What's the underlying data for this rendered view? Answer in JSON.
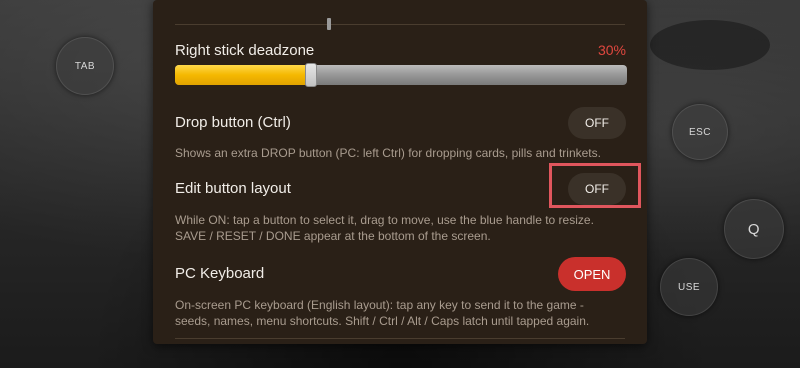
{
  "background_controls": {
    "tab_label": "TAB",
    "esc_label": "ESC",
    "q_label": "Q",
    "use_label": "USE"
  },
  "settings": {
    "deadzone": {
      "title": "Right stick deadzone",
      "value_text": "30%",
      "value_fraction": 0.3
    },
    "drop_button": {
      "title": "Drop button (Ctrl)",
      "toggle_label": "OFF",
      "description": "Shows an extra DROP button (PC: left Ctrl) for dropping cards, pills and trinkets."
    },
    "edit_layout": {
      "title": "Edit button layout",
      "toggle_label": "OFF",
      "description": "While ON: tap a button to select it, drag to move, use the blue handle to resize. SAVE / RESET / DONE appear at the bottom of the screen."
    },
    "pc_keyboard": {
      "title": "PC Keyboard",
      "button_label": "OPEN",
      "description": "On-screen PC keyboard (English layout): tap any key to send it to the game - seeds, names, menu shortcuts. Shift / Ctrl / Alt / Caps latch until tapped again."
    }
  },
  "colors": {
    "panel_bg": "#2a2017",
    "accent_red": "#e0473f",
    "open_button": "#c9302c",
    "slider_fill": "#f5b800",
    "highlight_box": "#e0565d"
  }
}
